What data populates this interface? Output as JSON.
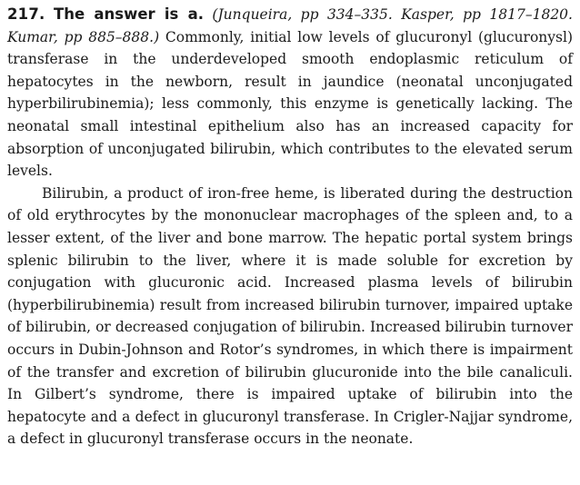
{
  "question_number": "217.",
  "answer_heading": "The answer is a.",
  "references": "(Junqueira, pp 334–335. Kasper, pp 1817–1820. Kumar, pp 885–888.)",
  "paragraph_1_body": "Commonly, initial low levels of glucuronyl (glu­curonysl) transferase in the underdeveloped smooth endoplasmic reticulum of hepatocytes in the newborn, result in jaundice (neonatal unconjugated hyperbilirubinemia); less commonly, this enzyme is genetically lacking. The neonatal small intestinal epithelium also has an increased capacity for absorption of unconjugated bilirubin, which contributes to the elevated serum levels.",
  "paragraph_2": "Bilirubin, a product of iron-free heme, is liberated during the destruc­tion of old erythrocytes by the mononuclear macrophages of the spleen and, to a lesser extent, of the liver and bone marrow. The hepatic portal sys­tem brings splenic bilirubin to the liver, where it is made soluble for excre­tion by conjugation with glucuronic acid. Increased plasma levels of bilirubin (hyperbilirubinemia) result from increased bilirubin turnover, impaired uptake of bilirubin, or decreased conjugation of bilirubin. Increased bilirubin turnover occurs in Dubin-Johnson and Rotor’s syn­dromes, in which there is impairment of the transfer and excretion of bilirubin glucuronide into the bile canaliculi. In Gilbert’s syndrome, there is impaired uptake of bilirubin into the hepatocyte and a defect in glu­curonyl transferase. In Crigler-Najjar syndrome, a defect in glucuronyl transferase occurs in the neonate."
}
